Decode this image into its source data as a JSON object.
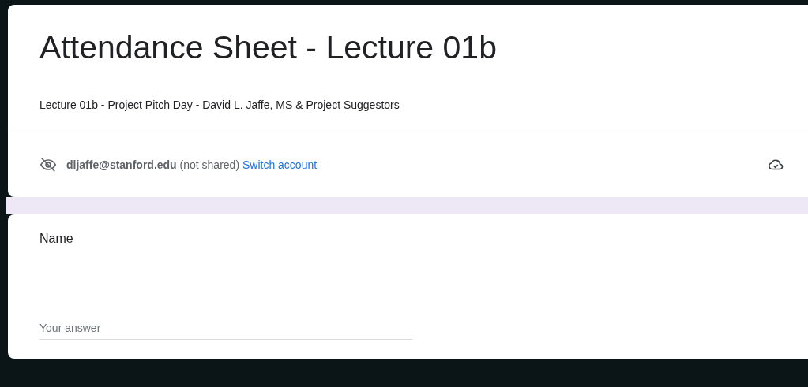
{
  "form": {
    "title": "Attendance Sheet - Lecture 01b",
    "description": "Lecture 01b - Project Pitch Day - David L. Jaffe, MS & Project Suggestors"
  },
  "account": {
    "email": "dljaffe@stanford.edu",
    "note": "(not shared)",
    "link": "Switch account"
  },
  "questions": [
    {
      "label": "Name",
      "placeholder": "Your answer"
    }
  ]
}
